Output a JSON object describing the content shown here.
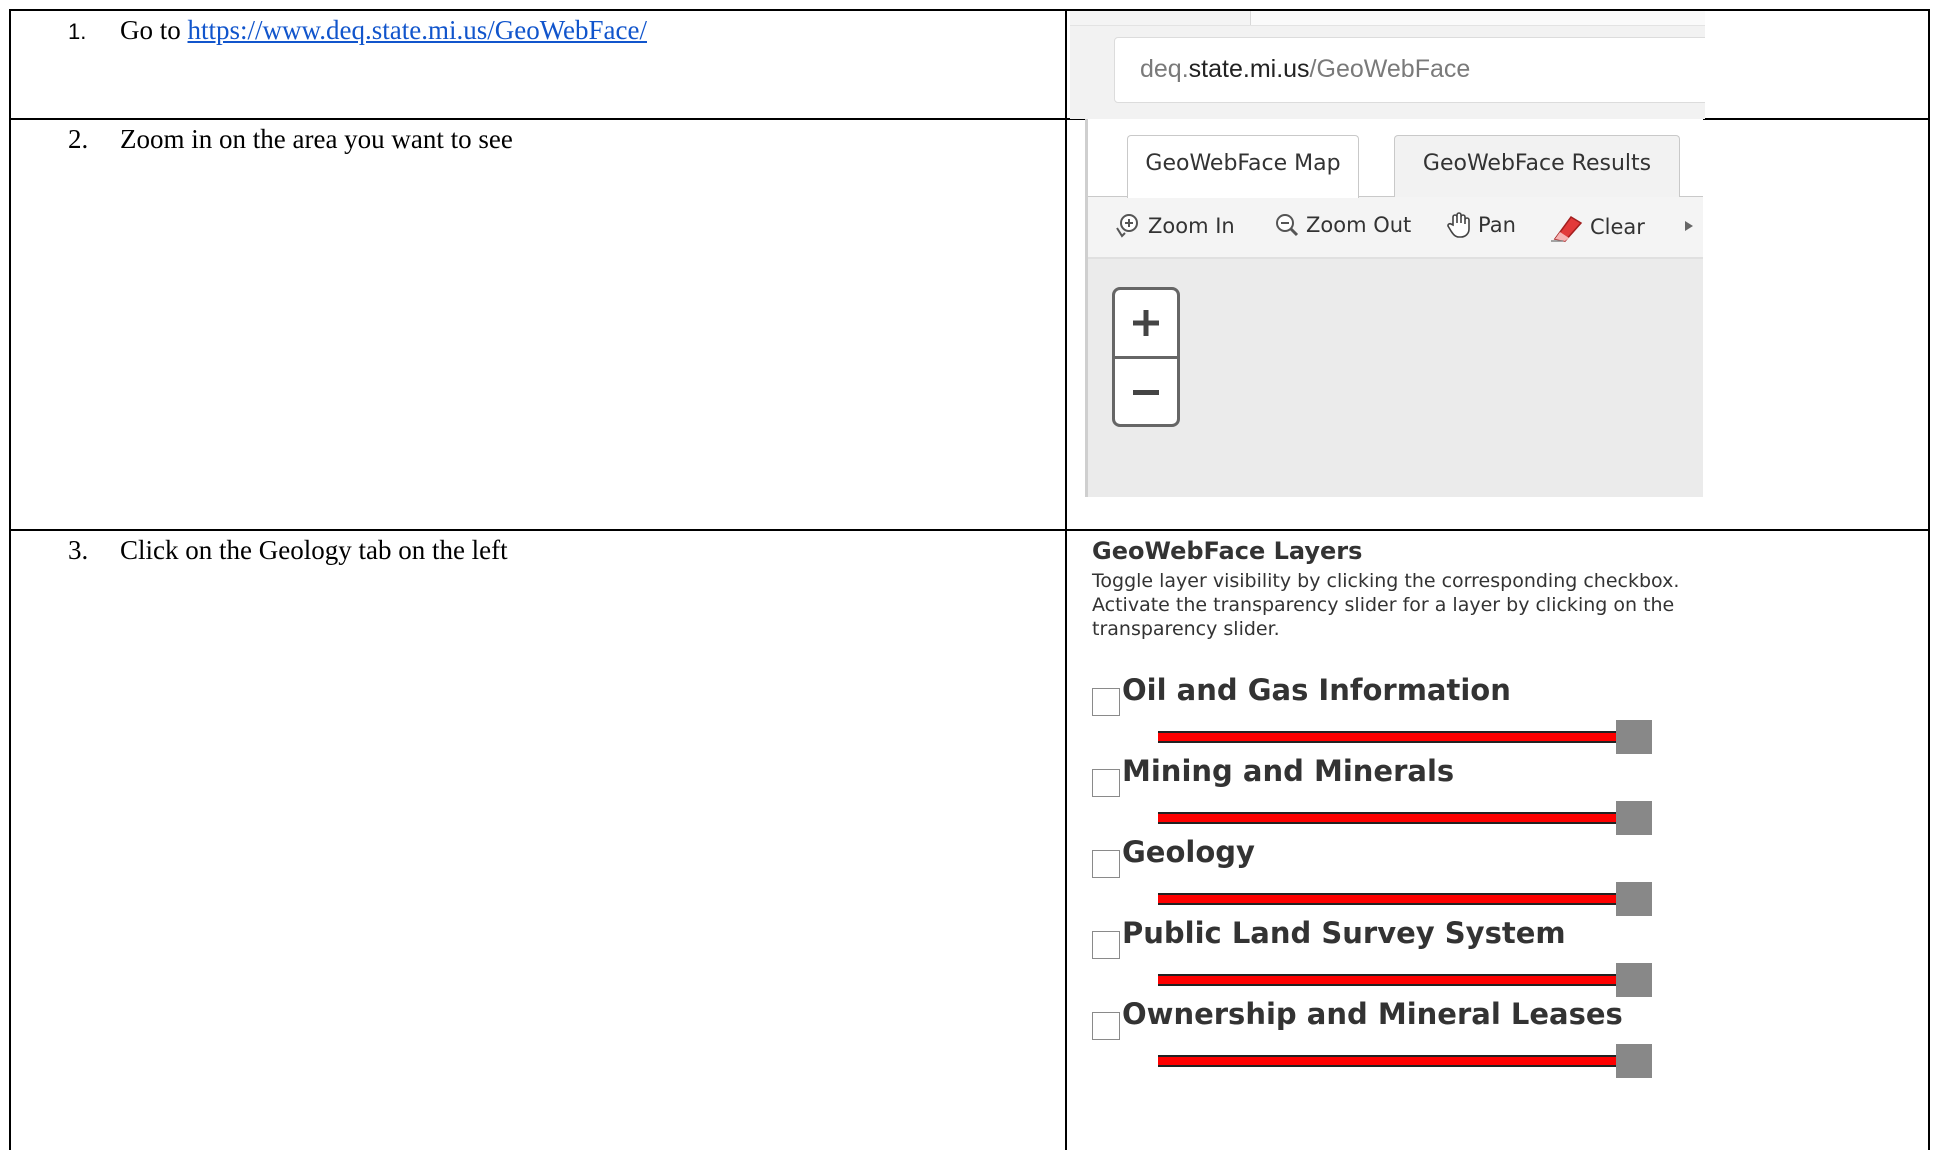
{
  "steps": [
    {
      "number": "1.",
      "text": "Go to ",
      "link": "https://www.deq.state.mi.us/GeoWebFace/"
    },
    {
      "number": "2.",
      "text": "Zoom in on the area you want to see"
    },
    {
      "number": "3.",
      "text": "Click on the Geology tab on the left"
    }
  ],
  "address_bar": {
    "prefix": "deq.",
    "domain": "state.mi.us",
    "path": "/GeoWebFace"
  },
  "map_panel": {
    "tabs": [
      {
        "label": "GeoWebFace Map",
        "active": true
      },
      {
        "label": "GeoWebFace Results",
        "active": false
      }
    ],
    "toolbar": [
      {
        "label": "Zoom In",
        "icon": "zoom-in-icon"
      },
      {
        "label": "Zoom Out",
        "icon": "zoom-out-icon"
      },
      {
        "label": "Pan",
        "icon": "hand-icon"
      },
      {
        "label": "Clear",
        "icon": "eraser-icon"
      }
    ],
    "zoom_control": {
      "plus": "+",
      "minus": "−"
    }
  },
  "layers_panel": {
    "title": "GeoWebFace Layers",
    "description": "Toggle layer visibility by clicking the corresponding checkbox. Activate the transparency slider for a layer by clicking on the transparency slider.",
    "slider_color": "#ff0000",
    "layers": [
      {
        "name": "Oil and Gas Information",
        "checked": false,
        "opacity": 1.0
      },
      {
        "name": "Mining and Minerals",
        "checked": false,
        "opacity": 1.0
      },
      {
        "name": "Geology",
        "checked": false,
        "opacity": 1.0
      },
      {
        "name": "Public Land Survey System",
        "checked": false,
        "opacity": 1.0
      },
      {
        "name": "Ownership and Mineral Leases",
        "checked": false,
        "opacity": 1.0
      }
    ]
  }
}
